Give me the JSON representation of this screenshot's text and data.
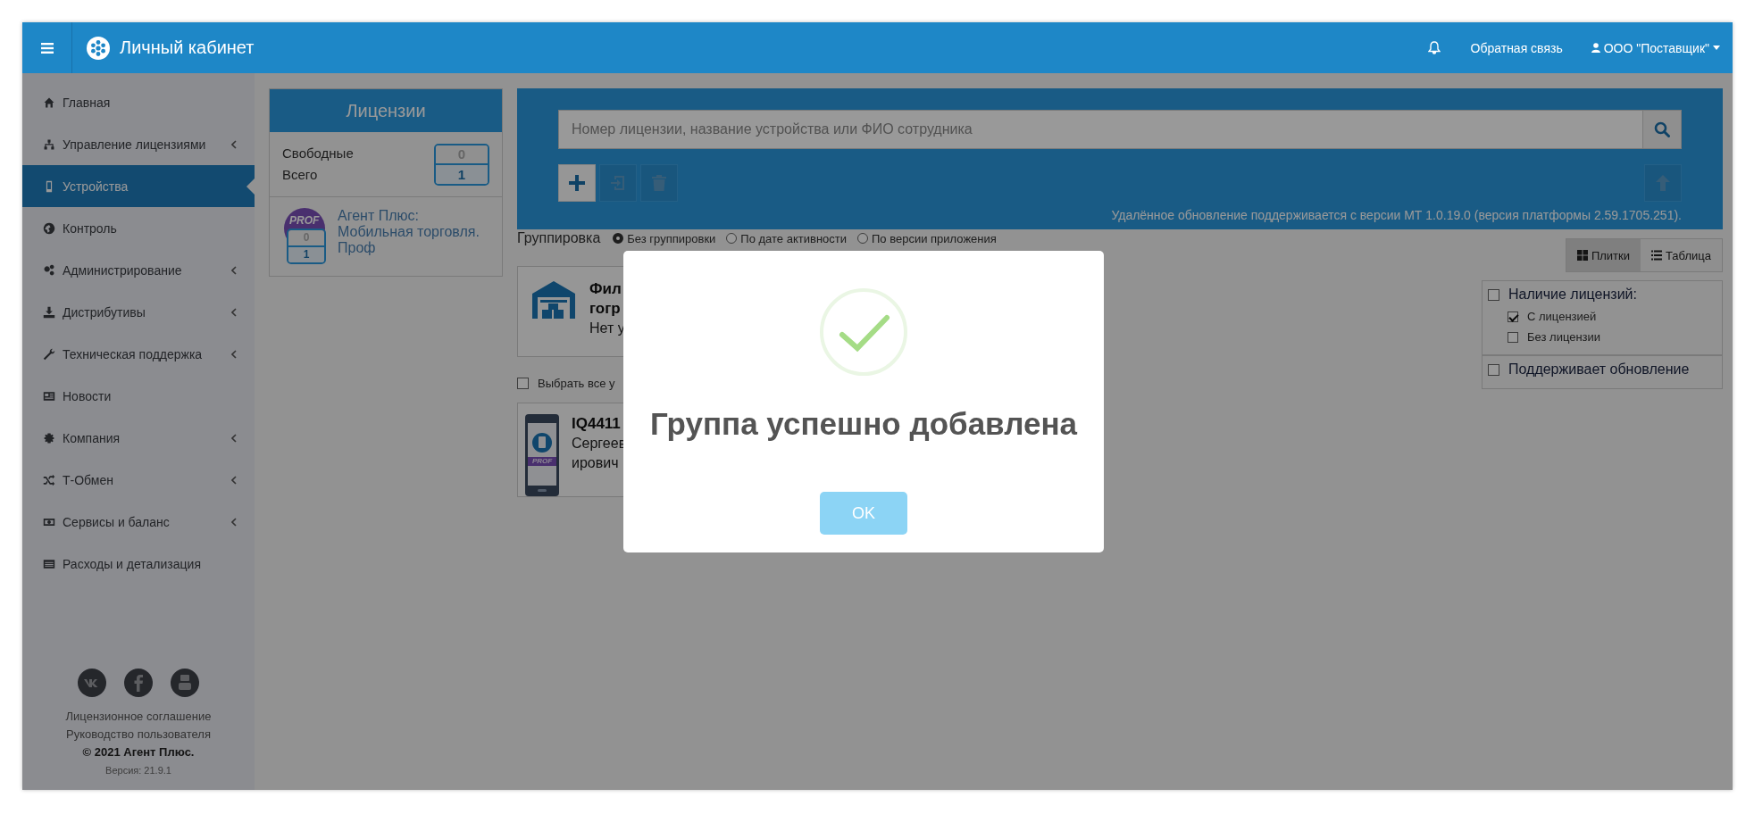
{
  "topbar": {
    "title": "Личный кабинет",
    "feedback": "Обратная связь",
    "user": "ООО \"Поставщик\""
  },
  "sidebar": {
    "items": [
      {
        "label": "Главная",
        "submenu": false,
        "selected": false
      },
      {
        "label": "Управление лицензиями",
        "submenu": true,
        "selected": false
      },
      {
        "label": "Устройства",
        "submenu": false,
        "selected": true
      },
      {
        "label": "Контроль",
        "submenu": false,
        "selected": false
      },
      {
        "label": "Администрирование",
        "submenu": true,
        "selected": false
      },
      {
        "label": "Дистрибутивы",
        "submenu": true,
        "selected": false
      },
      {
        "label": "Техническая поддержка",
        "submenu": true,
        "selected": false
      },
      {
        "label": "Новости",
        "submenu": false,
        "selected": false
      },
      {
        "label": "Компания",
        "submenu": true,
        "selected": false
      },
      {
        "label": "Т-Обмен",
        "submenu": true,
        "selected": false
      },
      {
        "label": "Сервисы и баланс",
        "submenu": true,
        "selected": false
      },
      {
        "label": "Расходы и детализация",
        "submenu": false,
        "selected": false
      }
    ],
    "footer": {
      "links": [
        "Лицензионное соглашение",
        "Руководство пользователя"
      ],
      "copyright": "© 2021 Агент Плюс.",
      "version": "Версия: 21.9.1"
    }
  },
  "licenses": {
    "title": "Лицензии",
    "free_label": "Свободные",
    "total_label": "Всего",
    "free": "0",
    "total": "1",
    "product": {
      "badge": "PROF",
      "free": "0",
      "total": "1",
      "name": "Агент Плюс: Мобильная торговля. Проф"
    }
  },
  "search": {
    "placeholder": "Номер лицензии, название устройства или ФИО сотрудника",
    "tools": [
      {
        "kind": "add",
        "disabled": false
      },
      {
        "kind": "import",
        "disabled": true
      },
      {
        "kind": "delete",
        "disabled": true
      }
    ],
    "upload": {
      "disabled": true
    },
    "note": "Удалённое обновление поддерживается с версии МТ 1.0.19.0 (версия платформы 2.59.1705.251)."
  },
  "grouping": {
    "label": "Группировка",
    "options": [
      {
        "label": "Без группировки",
        "selected": true
      },
      {
        "label": "По дате активности",
        "selected": false
      },
      {
        "label": "По версии приложения",
        "selected": false
      }
    ]
  },
  "group_tile": {
    "title_lines": [
      "Фил",
      "гогр"
    ],
    "subtitle": "Нет у"
  },
  "select_all": {
    "label": "Выбрать все у",
    "checked": false
  },
  "device": {
    "name": "IQ4411",
    "owner_lines": [
      "Сергеев",
      "ирович"
    ],
    "badge": "PROF"
  },
  "view": [
    {
      "label": "Плитки",
      "selected": true
    },
    {
      "label": "Таблица",
      "selected": false
    }
  ],
  "filters": [
    {
      "label": "Наличие лицензий:",
      "checked": false,
      "options": [
        {
          "label": "С лицензией",
          "checked": true
        },
        {
          "label": "Без лицензии",
          "checked": false
        }
      ]
    },
    {
      "label": "Поддерживает обновление",
      "checked": false
    }
  ],
  "dialog": {
    "title": "Группа успешно добавлена",
    "button": "OK"
  }
}
